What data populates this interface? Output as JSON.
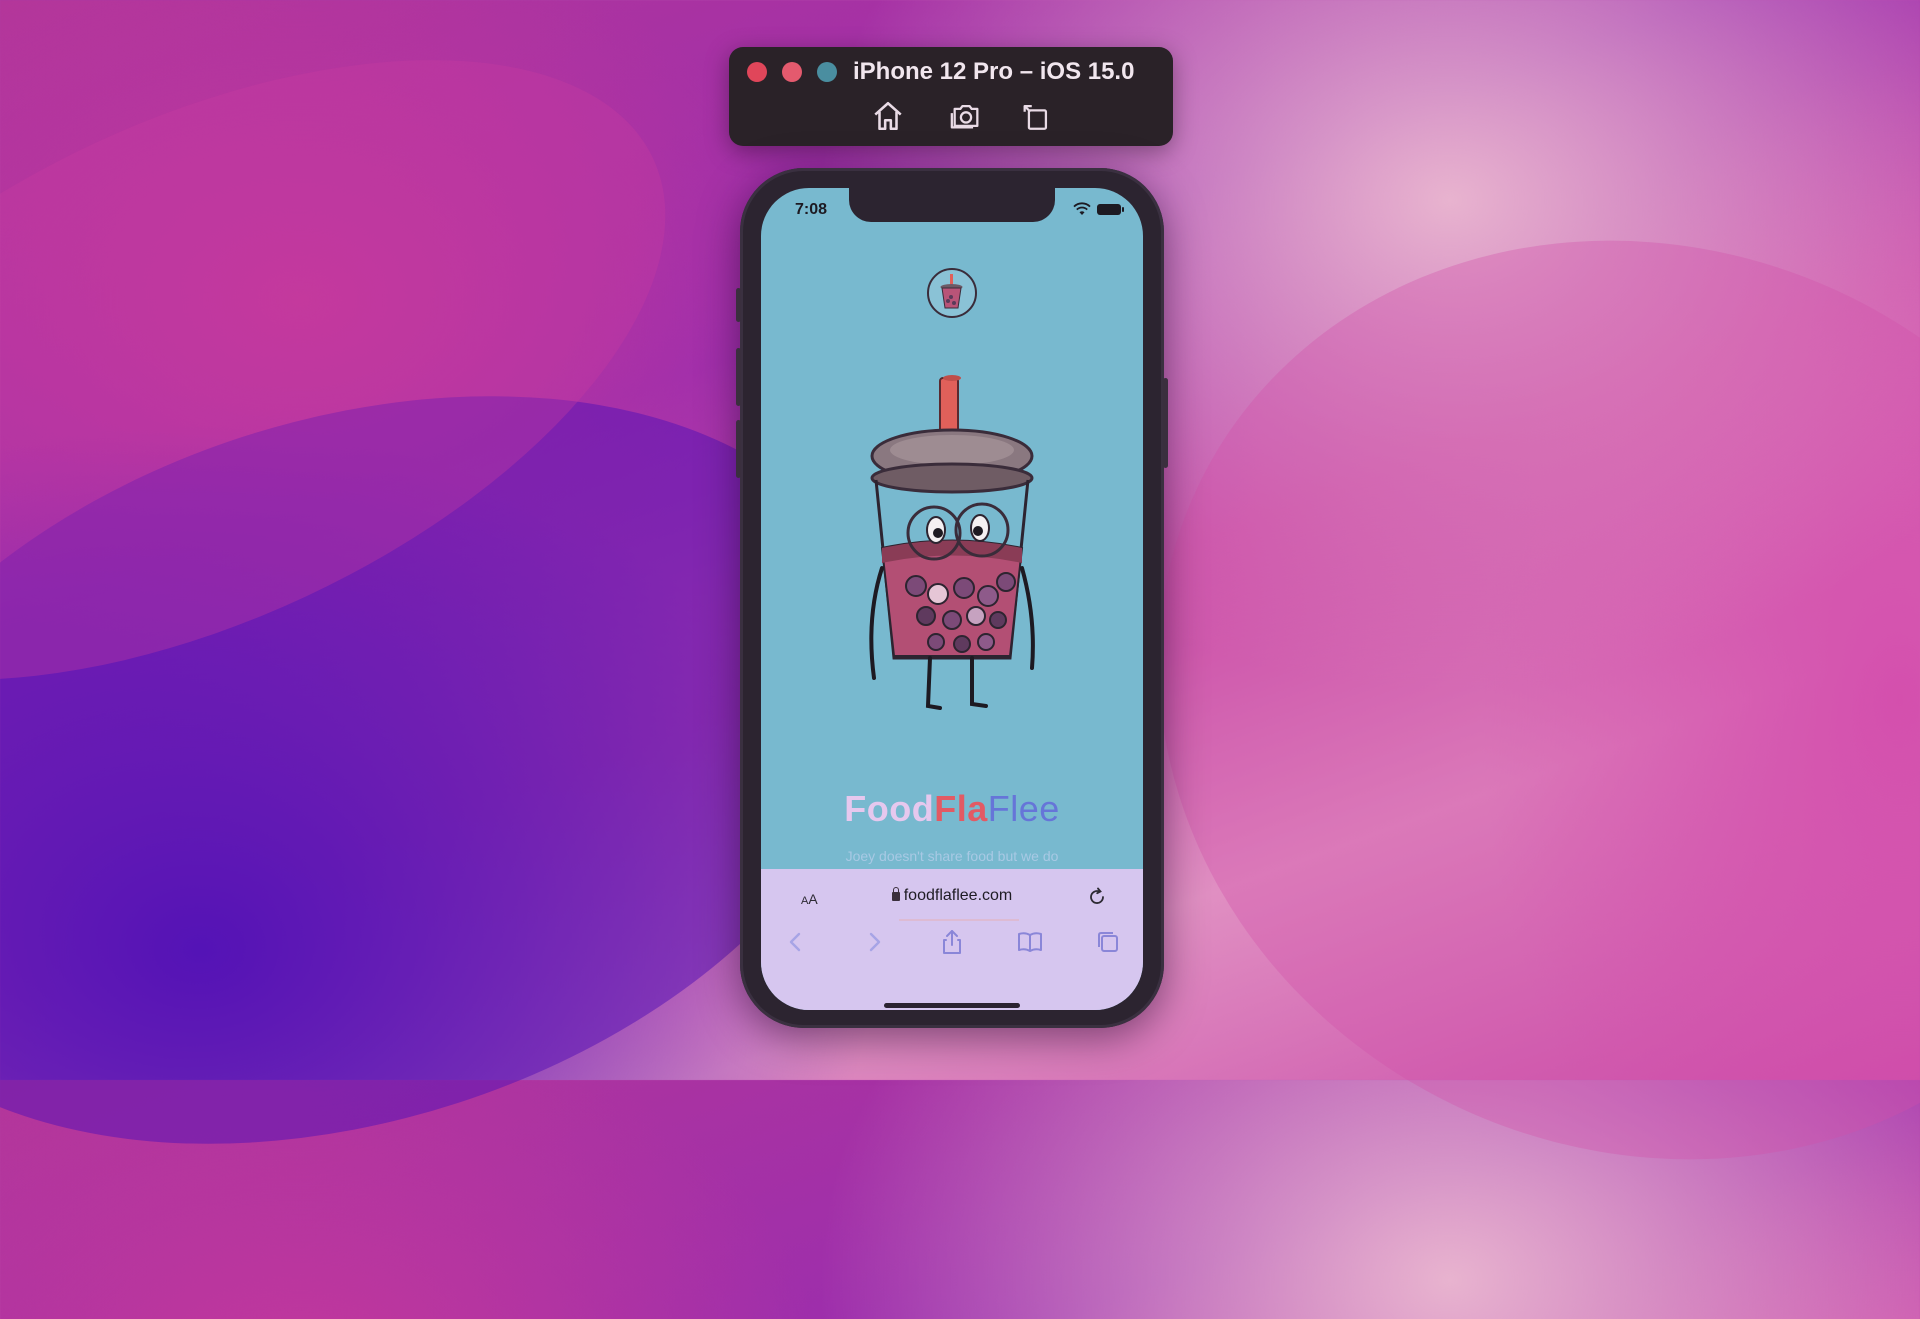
{
  "simulator": {
    "title": "iPhone 12 Pro – iOS 15.0",
    "buttons": [
      "home-icon",
      "screenshot-icon",
      "rotate-icon"
    ]
  },
  "status_bar": {
    "time": "7:08",
    "icons": [
      "wifi-icon",
      "battery-icon"
    ]
  },
  "page": {
    "brand": {
      "part1": "Food",
      "part2": "Fla",
      "part3": "Flee"
    },
    "tagline": "Joey doesn't share food but we do"
  },
  "safari": {
    "aa_small": "A",
    "aa_large": "A",
    "url": "foodflaflee.com"
  },
  "colors": {
    "screen_bg": "#78b9cf",
    "brand_food": "#e6c8ee",
    "brand_fla": "#e25a64",
    "brand_flee": "#6675d8",
    "toolbar_bg": "#d6c6ef"
  }
}
